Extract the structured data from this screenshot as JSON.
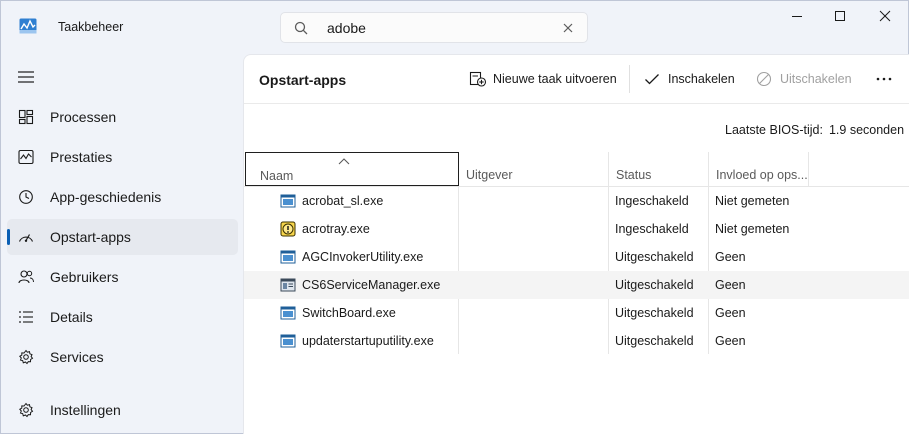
{
  "app": {
    "title": "Taakbeheer"
  },
  "search": {
    "value": "adobe"
  },
  "icons": {
    "app": "task-manager-icon",
    "search": "search-icon",
    "clear": "close-icon",
    "minimize": "minimize-icon",
    "maximize": "maximize-icon",
    "close": "close-icon"
  },
  "sidebar": {
    "items": [
      {
        "label": "Processen",
        "icon": "processes-icon"
      },
      {
        "label": "Prestaties",
        "icon": "performance-icon"
      },
      {
        "label": "App-geschiedenis",
        "icon": "app-history-icon"
      },
      {
        "label": "Opstart-apps",
        "icon": "startup-apps-icon",
        "active": true
      },
      {
        "label": "Gebruikers",
        "icon": "users-icon"
      },
      {
        "label": "Details",
        "icon": "details-icon"
      },
      {
        "label": "Services",
        "icon": "services-icon"
      }
    ],
    "settings_label": "Instellingen"
  },
  "main": {
    "title": "Opstart-apps",
    "toolbar": {
      "new_task": "Nieuwe taak uitvoeren",
      "enable": "Inschakelen",
      "disable": "Uitschakelen"
    },
    "bios_label": "Laatste BIOS-tijd:",
    "bios_value": "1.9 seconden",
    "columns": [
      "Naam",
      "Uitgever",
      "Status",
      "Invloed op ops..."
    ],
    "rows": [
      {
        "name": "acrobat_sl.exe",
        "publisher": "",
        "status": "Ingeschakeld",
        "impact": "Niet gemeten",
        "icon": "app-window-icon"
      },
      {
        "name": "acrotray.exe",
        "publisher": "",
        "status": "Ingeschakeld",
        "impact": "Niet gemeten",
        "icon": "warning-app-icon"
      },
      {
        "name": "AGCInvokerUtility.exe",
        "publisher": "",
        "status": "Uitgeschakeld",
        "impact": "Geen",
        "icon": "app-window-icon"
      },
      {
        "name": "CS6ServiceManager.exe",
        "publisher": "",
        "status": "Uitgeschakeld",
        "impact": "Geen",
        "icon": "service-manager-icon"
      },
      {
        "name": "SwitchBoard.exe",
        "publisher": "",
        "status": "Uitgeschakeld",
        "impact": "Geen",
        "icon": "app-window-icon"
      },
      {
        "name": "updaterstartuputility.exe",
        "publisher": "",
        "status": "Uitgeschakeld",
        "impact": "Geen",
        "icon": "app-window-icon"
      }
    ]
  },
  "colors": {
    "accent": "#0a5fb4",
    "sidebar_bg": "#f0f3f9",
    "panel_bg": "#ffffff",
    "active_item_bg": "#e6e9ef",
    "disabled_text": "#a0a0a0"
  }
}
